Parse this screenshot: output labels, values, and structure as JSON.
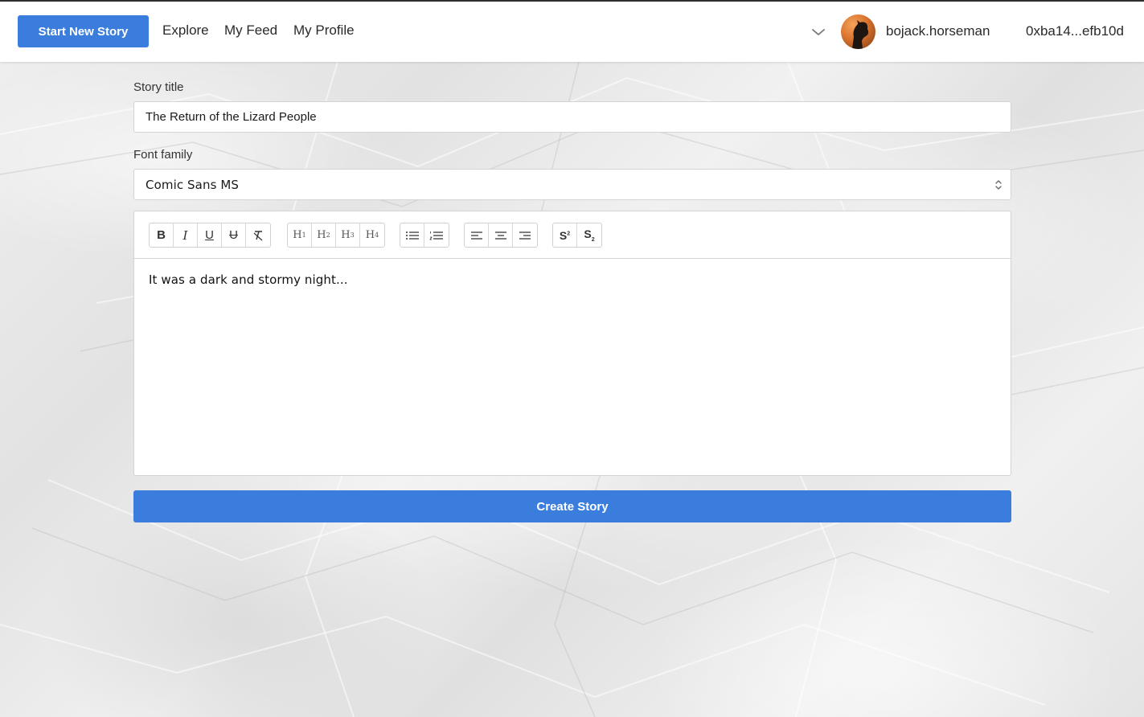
{
  "nav": {
    "start_button": "Start New Story",
    "links": [
      "Explore",
      "My Feed",
      "My Profile"
    ],
    "username": "bojack.horseman",
    "wallet": "0xba14...efb10d"
  },
  "form": {
    "title_label": "Story title",
    "title_value": "The Return of the Lizard People",
    "font_label": "Font family",
    "font_value": "Comic Sans MS"
  },
  "editor": {
    "content": "It was a dark and stormy night..."
  },
  "submit_label": "Create Story",
  "colors": {
    "accent": "#3b7ddd"
  }
}
